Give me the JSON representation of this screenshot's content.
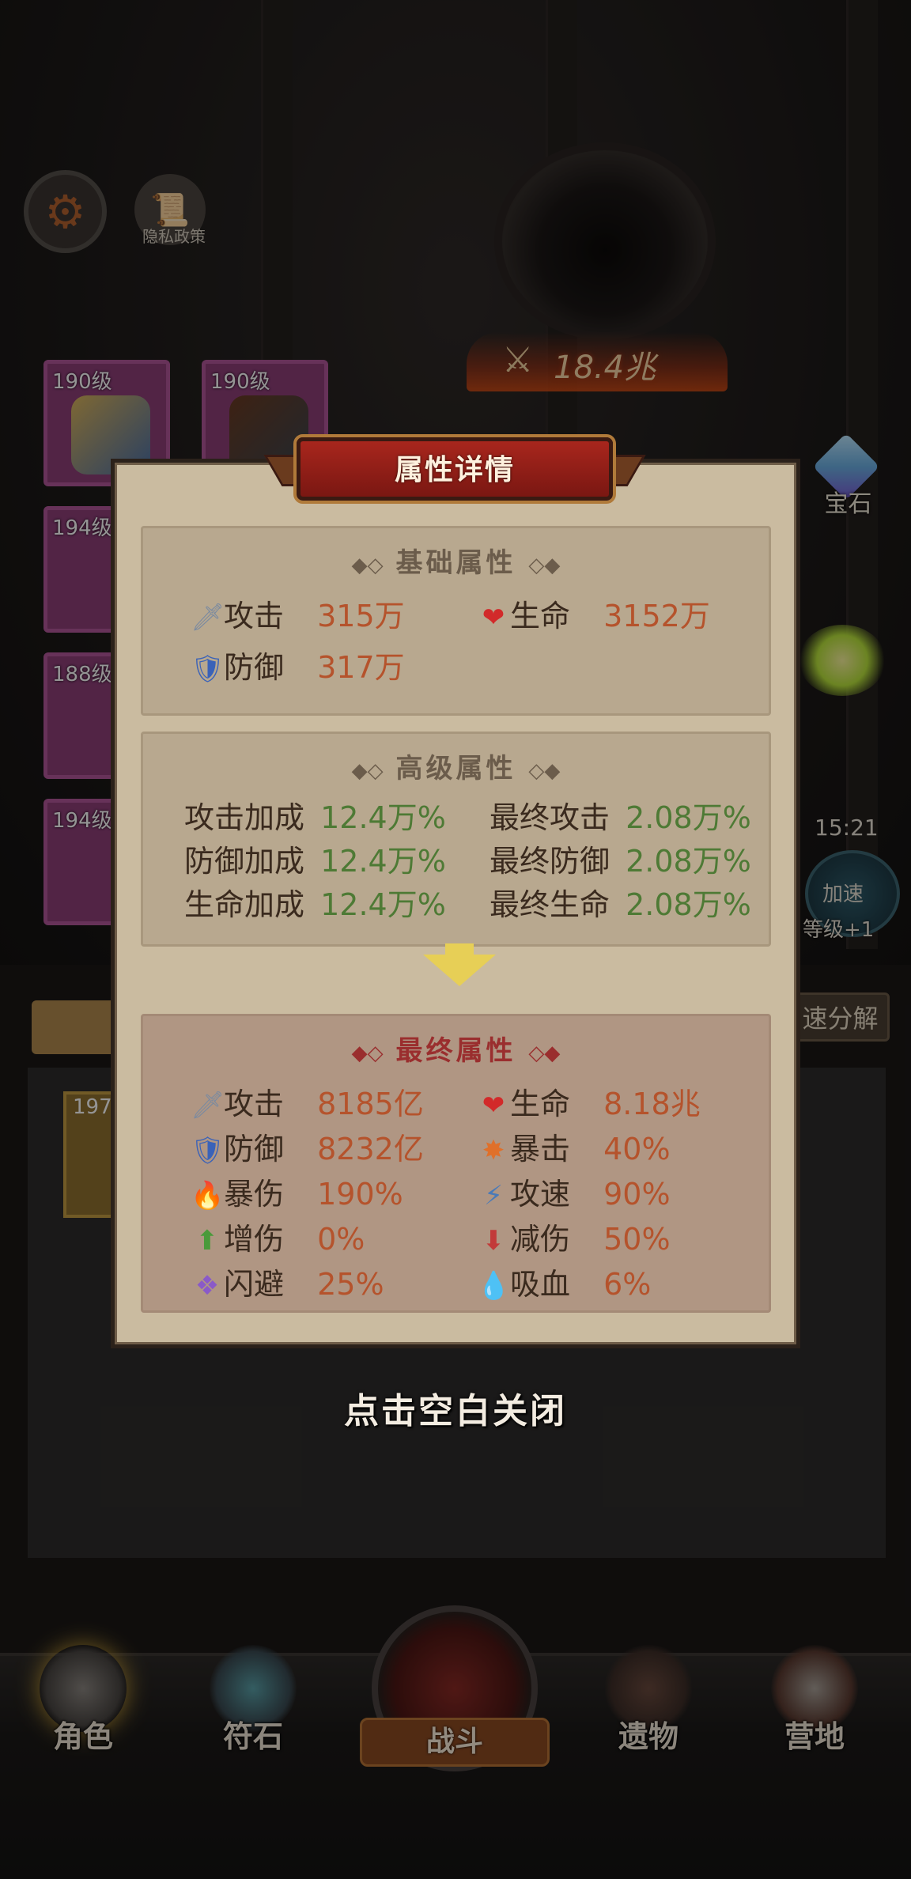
{
  "top": {
    "privacy_label": "隐私政策",
    "battle_power": "18.4兆"
  },
  "side": {
    "gem_label": "宝石",
    "timer": "15:21",
    "speed_label": "加速",
    "level_label": "等级+1",
    "decompose_label": "速分解"
  },
  "slots": [
    {
      "level": "190级"
    },
    {
      "level": "190级"
    },
    {
      "level": "194级"
    },
    {
      "level": "188级"
    },
    {
      "level": "194级"
    },
    {
      "level": "197"
    }
  ],
  "modal": {
    "title": "属性详情",
    "basic": {
      "heading": "基础属性",
      "attack_label": "攻击",
      "attack_value": "315万",
      "hp_label": "生命",
      "hp_value": "3152万",
      "defense_label": "防御",
      "defense_value": "317万"
    },
    "advanced": {
      "heading": "高级属性",
      "rows": [
        {
          "label1": "攻击加成",
          "value1": "12.4万%",
          "label2": "最终攻击",
          "value2": "2.08万%"
        },
        {
          "label1": "防御加成",
          "value1": "12.4万%",
          "label2": "最终防御",
          "value2": "2.08万%"
        },
        {
          "label1": "生命加成",
          "value1": "12.4万%",
          "label2": "最终生命",
          "value2": "2.08万%"
        }
      ]
    },
    "final": {
      "heading": "最终属性",
      "stats": [
        {
          "label": "攻击",
          "value": "8185亿",
          "icon": "sword-icon"
        },
        {
          "label": "生命",
          "value": "8.18兆",
          "icon": "heart-icon"
        },
        {
          "label": "防御",
          "value": "8232亿",
          "icon": "shield-icon"
        },
        {
          "label": "暴击",
          "value": "40%",
          "icon": "crit-burst-icon"
        },
        {
          "label": "暴伤",
          "value": "190%",
          "icon": "flame-icon"
        },
        {
          "label": "攻速",
          "value": "90%",
          "icon": "speed-sword-icon"
        },
        {
          "label": "增伤",
          "value": "0%",
          "icon": "damage-up-icon"
        },
        {
          "label": "减伤",
          "value": "50%",
          "icon": "damage-down-icon"
        },
        {
          "label": "闪避",
          "value": "25%",
          "icon": "dodge-icon"
        },
        {
          "label": "吸血",
          "value": "6%",
          "icon": "blood-drop-icon"
        }
      ]
    }
  },
  "close_hint": "点击空白关闭",
  "nav": [
    {
      "label": "角色",
      "icon": "knight-helmet-icon"
    },
    {
      "label": "符石",
      "icon": "rune-stone-icon"
    },
    {
      "label": "战斗",
      "icon": "crossed-swords-icon"
    },
    {
      "label": "遗物",
      "icon": "relic-book-icon"
    },
    {
      "label": "营地",
      "icon": "camp-tent-icon"
    }
  ],
  "colors": {
    "accent_red": "#a8261d",
    "value_orange": "#b5532c",
    "value_green": "#4e7a35",
    "parchment": "#cabba0"
  }
}
